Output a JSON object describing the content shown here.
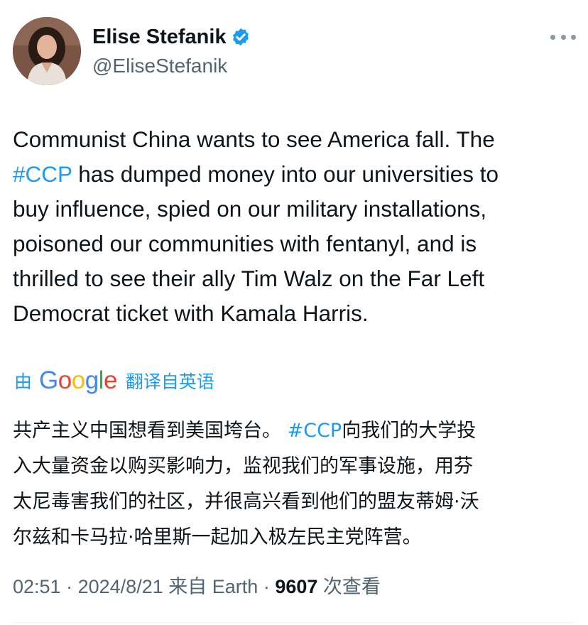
{
  "author": {
    "name": "Elise Stefanik",
    "handle": "@EliseStefanik",
    "verified_icon": "verified-badge-icon",
    "accent": "#1d9bf0"
  },
  "tweet": {
    "lines": [
      "Communist China wants to see America fall. The",
      " has dumped money into our universities to",
      "buy influence, spied on our military installations,",
      "poisoned our communities with fentanyl, and is",
      "thrilled to see their ally Tim Walz on the Far Left",
      "Democrat ticket with Kamala Harris."
    ],
    "hashtag": "#CCP"
  },
  "translation": {
    "by_label": "由",
    "google_letters": [
      "G",
      "o",
      "o",
      "g",
      "l",
      "e"
    ],
    "source_label": "翻译自英语",
    "lines": [
      "共产主义中国想看到美国垮台。",
      "入大量资金以购买影响力，监视我们的军事设施，用芬",
      "太尼毒害我们的社区，并很高兴看到他们的盟友蒂姆·沃",
      "尔兹和卡马拉·哈里斯一起加入极左民主党阵营。"
    ],
    "line1_after": "向我们的大学投",
    "hashtag": "#CCP"
  },
  "meta": {
    "time": "02:51",
    "date": "2024/8/21",
    "source": "来自 Earth",
    "separator": "·",
    "views_count": "9607",
    "views_label": "次查看"
  },
  "icons": {
    "more": "more-options-icon"
  }
}
